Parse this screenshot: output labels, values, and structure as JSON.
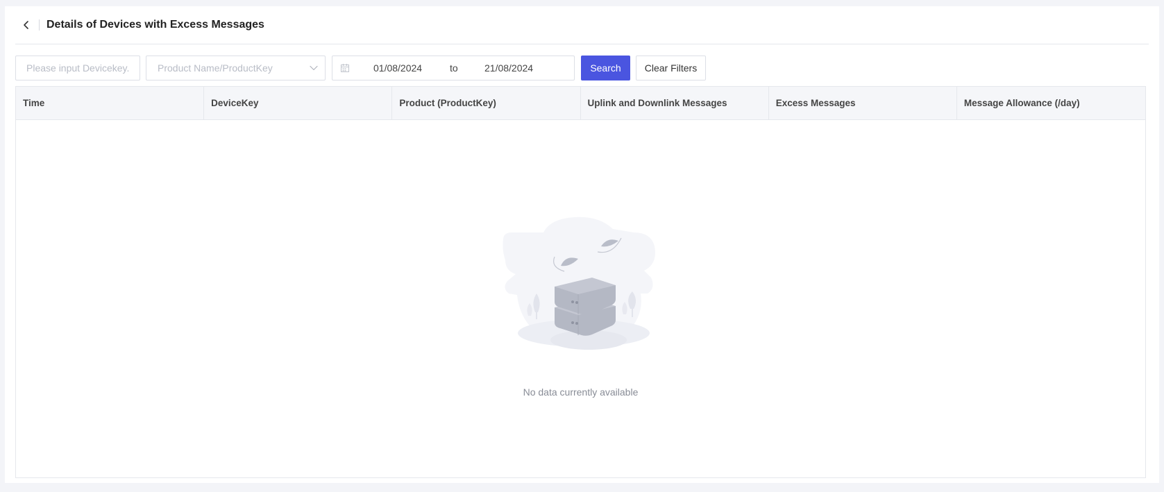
{
  "header": {
    "title": "Details of Devices with Excess Messages"
  },
  "filters": {
    "devicekey_placeholder": "Please input Devicekey.",
    "product_placeholder": "Product Name/ProductKey",
    "date_start": "01/08/2024",
    "date_separator": "to",
    "date_end": "21/08/2024",
    "search_label": "Search",
    "clear_label": "Clear Filters"
  },
  "table": {
    "columns": [
      "Time",
      "DeviceKey",
      "Product (ProductKey)",
      "Uplink and Downlink Messages",
      "Excess Messages",
      "Message Allowance (/day)"
    ],
    "rows": [],
    "empty_text": "No data currently available"
  },
  "colors": {
    "accent": "#4a55e0",
    "background": "#f3f4f8",
    "header_bg": "#f5f6f9"
  }
}
